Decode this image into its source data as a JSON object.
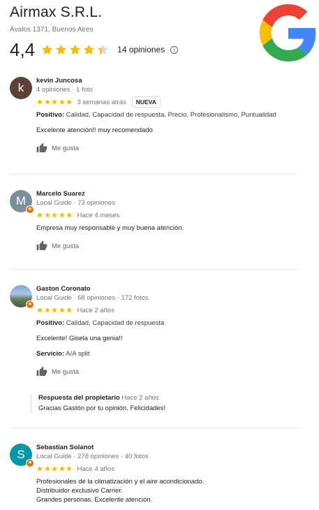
{
  "business": {
    "name": "Airmax S.R.L.",
    "address": "Ávalos 1371, Buenos Aires",
    "rating": "4,4",
    "rating_value": 4.4,
    "review_count": "14 opiniones",
    "info_glyph": "i"
  },
  "reviews": [
    {
      "name": "kevin Juncosa",
      "initial": "k",
      "avatar_color": "#5d4037",
      "meta": "4 opiniones · 1 foto",
      "time": "3 semanas atrás",
      "badge": "NUEVA",
      "rating": 5,
      "attributes_label": "Positivo:",
      "attributes": "Calidad, Capacidad de respuesta, Precio, Profesionalismo, Puntualidad",
      "text": "Excelente atención!! muy recomendado",
      "like": "Me gusta"
    },
    {
      "name": "Marcelo Suarez",
      "initial": "M",
      "avatar_color": "#78909c",
      "meta": "Local Guide · 73 opiniones",
      "time": "Hace 4 meses",
      "rating": 5,
      "text": "Empresa muy responsable y muy buena atención.",
      "like": "Me gusta"
    },
    {
      "name": "Gaston Coronato",
      "meta": "Local Guide · 68 opiniones · 172 fotos",
      "time": "Hace 2 años",
      "rating": 5,
      "attributes_label": "Positivo:",
      "attributes": "Calidad, Capacidad de respuesta",
      "text": "Excelente! Gisela una genia!!",
      "service_label": "Servicio:",
      "service": "A/A split",
      "like": "Me gusta",
      "owner_reply": {
        "label": "Respuesta del propietario",
        "time": "Hace 2 años",
        "text": "Gracias Gastón por tu opinión. Felicidades!"
      }
    },
    {
      "name": "Sebastian Solanot",
      "initial": "S",
      "avatar_color": "#0097a7",
      "meta": "Local Guide · 278 opiniones · 40 fotos",
      "time": "Hace 4 años",
      "rating": 5,
      "text_lines": [
        "Profesionales de la climatización y el aire acondicionado.",
        "Distribuidor exclusivo Carrier.",
        "Grandes personas. Excelente atención."
      ]
    }
  ],
  "colors": {
    "star": "#fbbc04",
    "star_empty": "#dadce0",
    "google_blue": "#4285f4",
    "google_red": "#ea4335",
    "google_yellow": "#fbbc05",
    "google_green": "#34a853",
    "local_guide_badge": "#e8710a"
  },
  "icons": {
    "logo": "google-g-logo",
    "star": "star-icon",
    "like": "thumbs-up-icon",
    "info": "info-icon",
    "badge": "local-guide-star-icon"
  }
}
